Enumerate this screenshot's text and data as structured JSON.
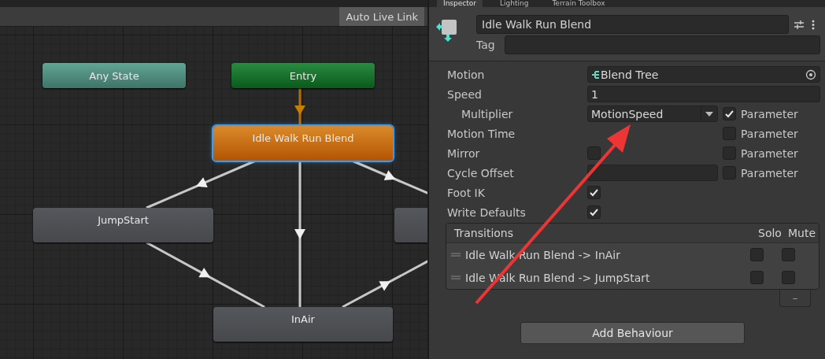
{
  "graph": {
    "toolbar": {
      "button": "Auto Live Link"
    },
    "nodes": [
      {
        "label": "Any State",
        "kind": "any",
        "selected": false
      },
      {
        "label": "Entry",
        "kind": "entry",
        "selected": false
      },
      {
        "label": "Idle Walk Run Blend",
        "kind": "default",
        "selected": true
      },
      {
        "label": "JumpStart",
        "kind": "state",
        "selected": false
      },
      {
        "kind": "state",
        "selected": false
      },
      {
        "label": "InAir",
        "kind": "state",
        "selected": false
      }
    ]
  },
  "inspector": {
    "tabs": [
      {
        "label": "Inspector",
        "selected": true
      },
      {
        "label": "Lighting",
        "selected": false
      },
      {
        "label": "Terrain Toolbox",
        "selected": false
      }
    ],
    "name": "Idle Walk Run Blend",
    "tag_label": "Tag",
    "properties": [
      {
        "label": "Motion",
        "kind": "object",
        "value": "Blend Tree"
      },
      {
        "label": "Speed",
        "kind": "field",
        "value": "1"
      },
      {
        "label": "Multiplier",
        "kind": "dropdown",
        "value": "MotionSpeed",
        "indented": true,
        "parameter": {
          "label": "Parameter",
          "checked": true
        }
      },
      {
        "label": "Motion Time",
        "kind": "none",
        "parameter": {
          "label": "Parameter",
          "checked": false
        }
      },
      {
        "label": "Mirror",
        "kind": "checkbox",
        "checked": false,
        "parameter": {
          "label": "Parameter",
          "checked": false
        }
      },
      {
        "label": "Cycle Offset",
        "kind": "field",
        "parameter": {
          "label": "Parameter",
          "checked": false
        }
      },
      {
        "label": "Foot IK",
        "kind": "checkbox",
        "checked": true
      },
      {
        "label": "Write Defaults",
        "kind": "checkbox",
        "checked": true
      }
    ],
    "transitions": {
      "title": "Transitions",
      "solo_label": "Solo",
      "mute_label": "Mute",
      "remove_button": "–",
      "rows": [
        {
          "label": "Idle Walk Run Blend -> InAir",
          "solo": false,
          "mute": false
        },
        {
          "label": "Idle Walk Run Blend -> JumpStart",
          "solo": false,
          "mute": false
        }
      ]
    },
    "add_button": "Add Behaviour"
  }
}
